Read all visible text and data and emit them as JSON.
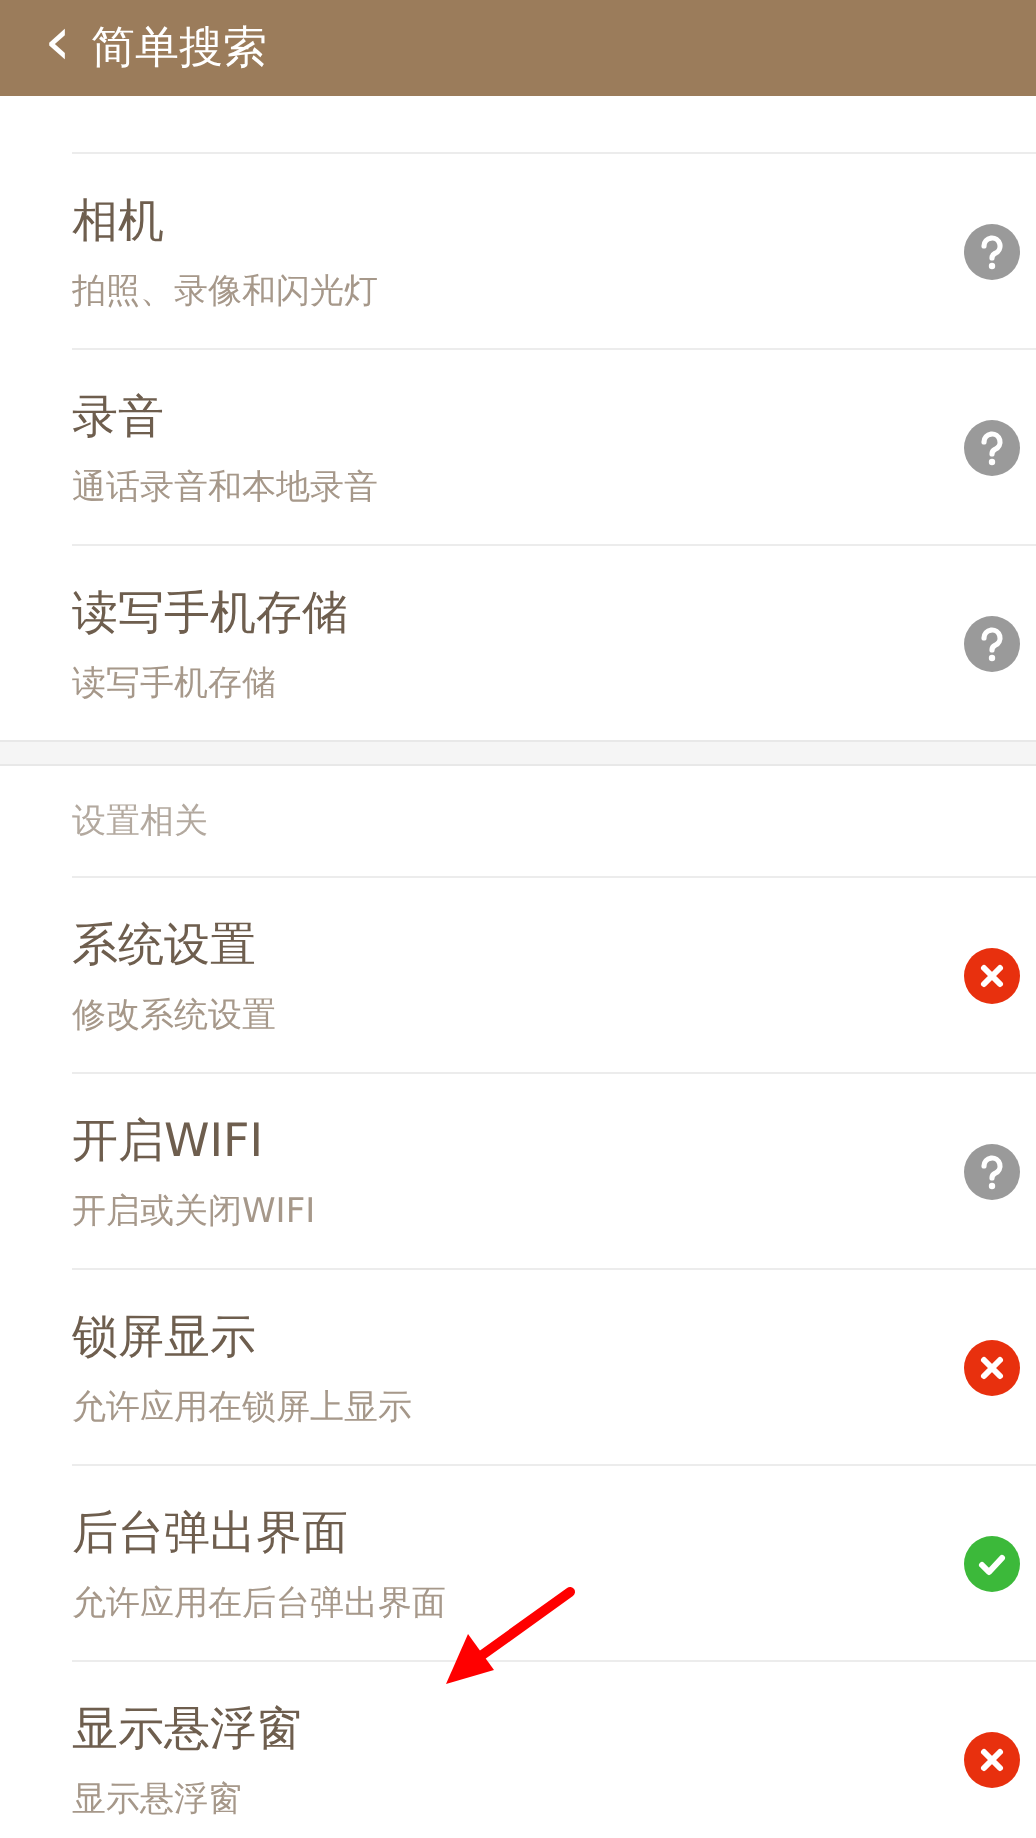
{
  "header": {
    "back_icon": "‹",
    "title": "简单搜索"
  },
  "sections": [
    {
      "items": [
        {
          "title": "相机",
          "subtitle": "拍照、录像和闪光灯",
          "kind": "ask"
        },
        {
          "title": "录音",
          "subtitle": "通话录音和本地录音",
          "kind": "ask"
        },
        {
          "title": "读写手机存储",
          "subtitle": "读写手机存储",
          "kind": "ask"
        }
      ]
    },
    {
      "label": "设置相关",
      "items": [
        {
          "title": "系统设置",
          "subtitle": "修改系统设置",
          "kind": "deny"
        },
        {
          "title": "开启WIFI",
          "subtitle": "开启或关闭WIFI",
          "kind": "ask"
        },
        {
          "title": "锁屏显示",
          "subtitle": "允许应用在锁屏上显示",
          "kind": "deny"
        },
        {
          "title": "后台弹出界面",
          "subtitle": "允许应用在后台弹出界面",
          "kind": "allow"
        },
        {
          "title": "显示悬浮窗",
          "subtitle": "显示悬浮窗",
          "kind": "deny"
        }
      ]
    }
  ]
}
